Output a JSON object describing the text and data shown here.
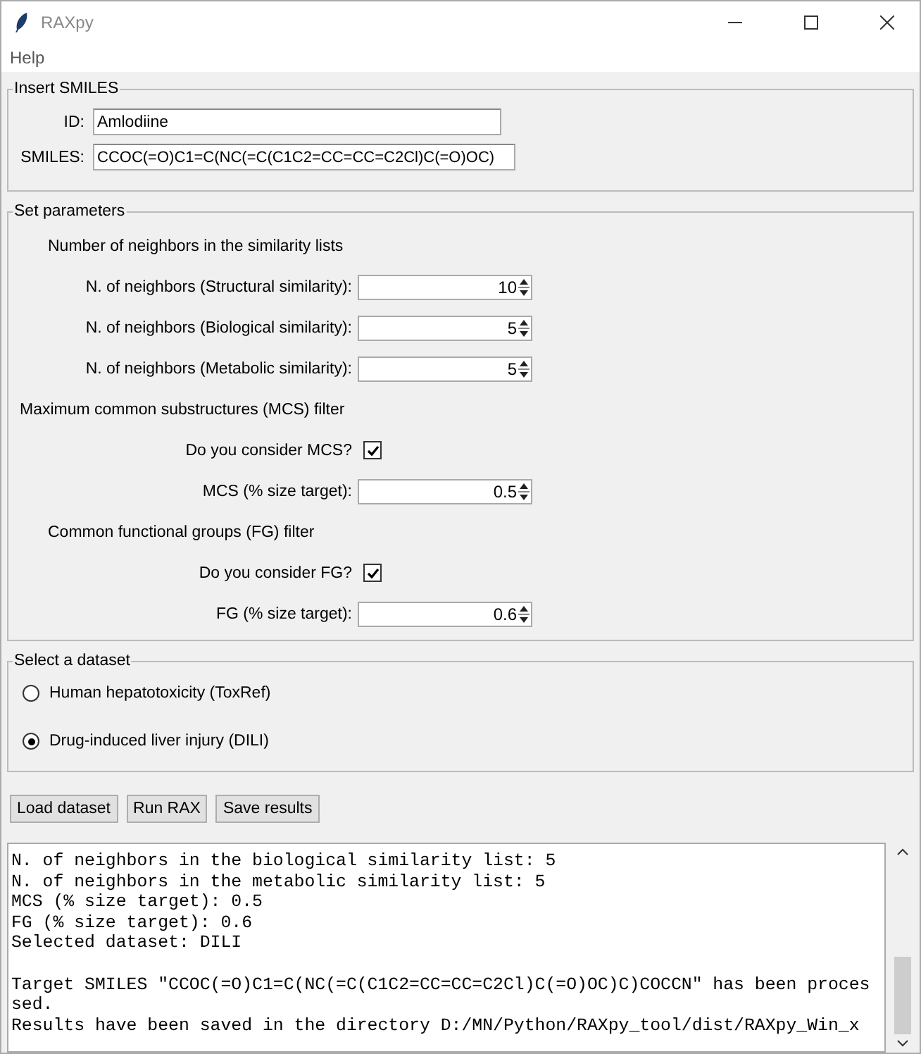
{
  "window": {
    "title": "RAXpy"
  },
  "menu": [
    "Help"
  ],
  "insert_smiles": {
    "title": "Insert SMILES",
    "fields": [
      {
        "label": "ID:",
        "value": "Amlodiine"
      },
      {
        "label": "SMILES:",
        "value": "CCOC(=O)C1=C(NC(=C(C1C2=CC=CC=C2Cl)C(=O)OC)"
      }
    ]
  },
  "set_parameters": {
    "title": "Set parameters",
    "rows": [
      {
        "kind": "heading",
        "label": "Number of neighbors in the similarity lists"
      },
      {
        "kind": "spin",
        "label": "N. of neighbors (Structural similarity):",
        "value": "10"
      },
      {
        "kind": "spin",
        "label": "N. of neighbors (Biological similarity):",
        "value": "5"
      },
      {
        "kind": "spin",
        "label": "N. of neighbors (Metabolic similarity):",
        "value": "5"
      },
      {
        "kind": "section",
        "label": "Maximum common substructures (MCS) filter"
      },
      {
        "kind": "check",
        "label": "Do you consider MCS?",
        "checked": true
      },
      {
        "kind": "spin",
        "label": "MCS (% size target):",
        "value": "0.5"
      },
      {
        "kind": "heading",
        "label": "Common functional groups (FG) filter"
      },
      {
        "kind": "check",
        "label": "Do you consider FG?",
        "checked": true
      },
      {
        "kind": "spin",
        "label": "FG (% size target):",
        "value": "0.6"
      }
    ]
  },
  "dataset": {
    "title": "Select a dataset",
    "options": [
      {
        "label": "Human hepatotoxicity (ToxRef)",
        "selected": false
      },
      {
        "label": "Drug-induced liver injury (DILI)",
        "selected": true
      }
    ]
  },
  "buttons": [
    "Load dataset",
    "Run RAX",
    "Save results"
  ],
  "log": [
    [
      "N. of neighbors in the biological similarity list: 5",
      "N. of neighbors in the metabolic similarity list: 5",
      "MCS (% size target): 0.5",
      "FG (% size target): 0.6",
      "Selected dataset: DILI"
    ],
    [
      "Target SMILES \"CCOC(=O)C1=C(NC(=C(C1C2=CC=CC=C2Cl)C(=O)OC)C)COCCN\" has been proces",
      "sed.",
      "Results have been saved in the directory D:/MN/Python/RAXpy_tool/dist/RAXpy_Win_x"
    ]
  ]
}
